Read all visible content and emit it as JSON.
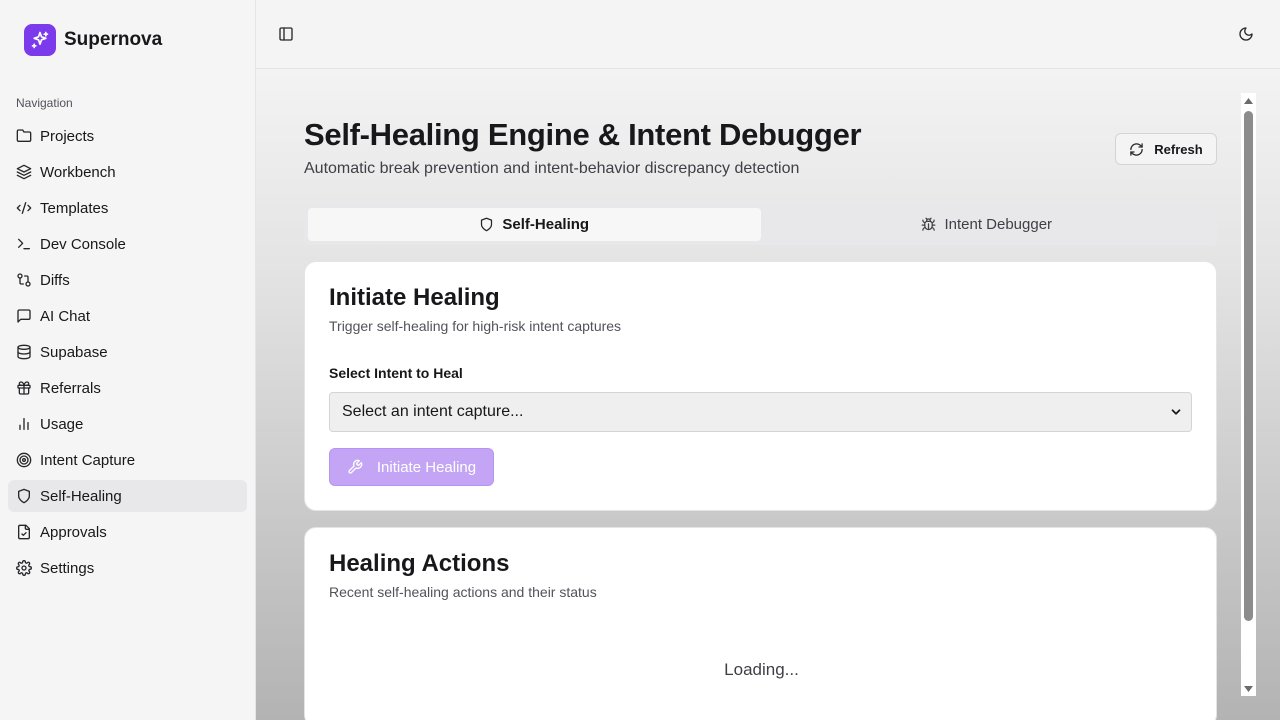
{
  "app": {
    "name": "Supernova",
    "logo_icon": "sparkles-icon",
    "accent": "#7c3aed"
  },
  "sidebar": {
    "heading": "Navigation",
    "items": [
      {
        "label": "Projects",
        "icon": "folder-icon",
        "active": false
      },
      {
        "label": "Workbench",
        "icon": "layers-icon",
        "active": false
      },
      {
        "label": "Templates",
        "icon": "code-icon",
        "active": false
      },
      {
        "label": "Dev Console",
        "icon": "terminal-icon",
        "active": false
      },
      {
        "label": "Diffs",
        "icon": "git-compare-icon",
        "active": false
      },
      {
        "label": "AI Chat",
        "icon": "message-square-icon",
        "active": false
      },
      {
        "label": "Supabase",
        "icon": "database-icon",
        "active": false
      },
      {
        "label": "Referrals",
        "icon": "gift-icon",
        "active": false
      },
      {
        "label": "Usage",
        "icon": "bar-chart-icon",
        "active": false
      },
      {
        "label": "Intent Capture",
        "icon": "target-icon",
        "active": false
      },
      {
        "label": "Self-Healing",
        "icon": "shield-icon",
        "active": true
      },
      {
        "label": "Approvals",
        "icon": "file-check-icon",
        "active": false
      },
      {
        "label": "Settings",
        "icon": "gear-icon",
        "active": false
      }
    ]
  },
  "topbar": {
    "toggle_icon": "panel-left-icon",
    "theme_icon": "moon-icon"
  },
  "page": {
    "title": "Self-Healing Engine & Intent Debugger",
    "subtitle": "Automatic break prevention and intent-behavior discrepancy detection",
    "refresh_label": "Refresh",
    "refresh_icon": "refresh-icon"
  },
  "tabs": [
    {
      "label": "Self-Healing",
      "icon": "shield-icon",
      "active": true
    },
    {
      "label": "Intent Debugger",
      "icon": "bug-icon",
      "active": false
    }
  ],
  "initiate_card": {
    "title": "Initiate Healing",
    "description": "Trigger self-healing for high-risk intent captures",
    "field_label": "Select Intent to Heal",
    "select_value": "Select an intent capture...",
    "button_label": "Initiate Healing",
    "button_icon": "wrench-icon",
    "button_color": "#c4a5f5"
  },
  "actions_card": {
    "title": "Healing Actions",
    "description": "Recent self-healing actions and their status",
    "loading_text": "Loading..."
  }
}
